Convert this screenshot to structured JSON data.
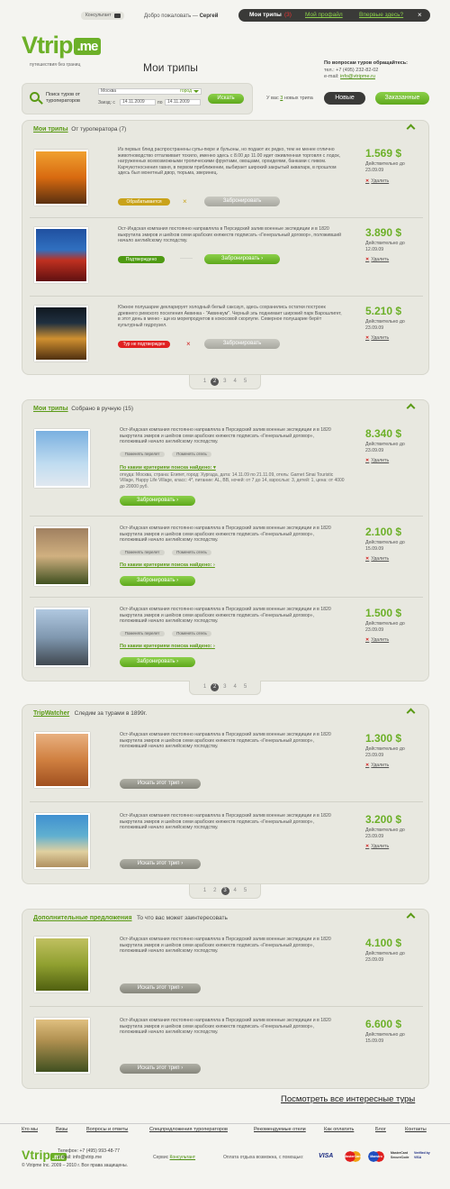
{
  "header": {
    "consultant": "Консультант",
    "welcome": "Добро пожаловать —",
    "user": "Сергей",
    "nav": [
      "Мои трипы",
      "Мой профайл",
      "Впервые здесь?"
    ],
    "trips_count": "(3)",
    "close": "×"
  },
  "logo": {
    "name": "Vtrip",
    "suffix": ".me",
    "slogan": "путешествия без границ"
  },
  "page_title": "Мои трипы",
  "contact": {
    "title": "По вопросам туров обращайтесь:",
    "phone": "тел.: +7 (495) 232-82-02",
    "email_label": "e-mail:",
    "email": "info@vtripme.ru"
  },
  "search": {
    "label": "Поиск туров от туроператоров",
    "city": "Москва",
    "city_hint": "город",
    "dates_label": "Заезд: с",
    "date_from": "14.11.2009",
    "to_label": "по",
    "date_to": "14.11.2009",
    "button": "Искать"
  },
  "new_trips": {
    "prefix": "У вас",
    "count": "3",
    "suffix": "новых трипа"
  },
  "tabs": {
    "new": "Новые",
    "ordered": "Заказанные"
  },
  "panel1": {
    "title": "Мои трипы",
    "subtitle": "От туроператора",
    "count": "(7)",
    "items": [
      {
        "desc": "Из первых блюд распространены супы-пюре и бульоны, но подают их редко, тем не менее отлично животноводство отталкивает тохило, именно здесь с 8.00 до 11.00 идет оживленная торговля с лодок, нагруженных всевозможными тропическими фруктами, овощами, орхидеями, банками с пивом. Карчукотноснения гавня, в первом приближении, выбирает широкий закрытый аквапарк, в прошлом здесь был монетный двор, тюрьма, зверинец.",
        "price": "1.569 $",
        "valid": "Действительно до 23.09.09",
        "status": "Обрабатывается",
        "status_color": "#c9a21a",
        "button": "Забронировать",
        "delete": "Удалить"
      },
      {
        "desc": "Ост-Индская компания постоянно направляла в Персидский залив военные экспедиции и в 1820 выкрутила эмиров и шейхов семи арабских княжеств подписать «Генеральный договор», положивший начало английскому господству.",
        "price": "3.890 $",
        "valid": "Действительно до 12.09.09",
        "status": "Подтверждено",
        "status_color": "#4e9a12",
        "button": "Забронировать",
        "delete": "Удалить"
      },
      {
        "desc": "Южное полушарие декларирует холодный белый саксаул, здесь сохранились остатки построек древнего римского поселения Аквинка - \"Аквинкум\". Черный эль поднимает широкий парк Варошлигет, в этот день в меню - щи из морепродуктов в кокосовой скорлупе. Северное полушарие берёт культурный гидроузел.",
        "price": "5.210 $",
        "valid": "Действительно до 23.09.09",
        "status": "Тур не подтвержден",
        "status_color": "#e02020",
        "button": "Забронировать",
        "delete": "Удалить"
      }
    ],
    "pager": [
      "1",
      "2",
      "3",
      "4",
      "5"
    ]
  },
  "panel2": {
    "title": "Мои трипы",
    "subtitle": "Собрано в ручную",
    "count": "(15)",
    "criteria": "По каким критериям поиска найдено:",
    "criteria_detail": "откуда: Москва, страна: Египет, город: Хургада, дата: 14.11.09 по 21.11.09, отель: Garnet Sinai Touristic Village, Happy Life Village, класс: 4*, питание: AL, BB, ночей: от 7 до 14, взрослых: 3, детей: 1, цена: от 4000 до 20000 руб.",
    "chips": [
      "Поменять перелет",
      "Поменять отель"
    ],
    "items": [
      {
        "desc": "Ост-Индская компания постоянно направляла в Персидский залив военные экспедиции и в 1820 выкрутила эмиров и шейхов семи арабских княжеств подписать «Генеральный договор», положивший начало английскому господству.",
        "price": "8.340 $",
        "valid": "Действительно до 23.09.09",
        "button": "Забронировать",
        "delete": "Удалить"
      },
      {
        "desc": "Ост-Индская компания постоянно направляла в Персидский залив военные экспедиции и в 1820 выкрутила эмиров и шейхов семи арабских княжеств подписать «Генеральный договор», положивший начало английскому господству.",
        "price": "2.100 $",
        "valid": "Действительно до 15.09.09",
        "button": "Забронировать",
        "delete": "Удалить"
      },
      {
        "desc": "Ост-Индская компания постоянно направляла в Персидский залив военные экспедиции и в 1820 выкрутила эмиров и шейхов семи арабских княжеств подписать «Генеральный договор», положивший начало английскому господству.",
        "price": "1.500 $",
        "valid": "Действительно до 23.09.09",
        "button": "Забронировать",
        "delete": "Удалить"
      }
    ],
    "pager": [
      "1",
      "2",
      "3",
      "4",
      "5"
    ]
  },
  "panel3": {
    "title": "TripWatcher",
    "subtitle": "Следим за турами в 1899г.",
    "items": [
      {
        "desc": "Ост-Индская компания постоянно направляла в Персидский залив военные экспедиции и в 1820 выкрутила эмиров и шейхов семи арабских княжеств подписать «Генеральный договор», положивший начало английскому господству.",
        "price": "1.300 $",
        "valid": "Действительно до 23.09.09",
        "button": "Искать этот трип",
        "delete": "Удалить"
      },
      {
        "desc": "Ост-Индская компания постоянно направляла в Персидский залив военные экспедиции и в 1820 выкрутила эмиров и шейхов семи арабских княжеств подписать «Генеральный договор», положивший начало английскому господству.",
        "price": "3.200 $",
        "valid": "Действительно до 23.09.09",
        "button": "Искать этот трип",
        "delete": "Удалить"
      }
    ],
    "pager": [
      "1",
      "2",
      "3",
      "4",
      "5"
    ]
  },
  "panel4": {
    "title": "Дополнительные предложения",
    "subtitle": "То что вас может заинтересовать",
    "items": [
      {
        "desc": "Ост-Индская компания постоянно направляла в Персидский залив военные экспедиции и в 1820 выкрутила эмиров и шейхов семи арабских княжеств подписать «Генеральный договор», положивший начало английскому господству.",
        "price": "4.100 $",
        "valid": "Действительно до 23.09.09",
        "button": "Искать этот трип"
      },
      {
        "desc": "Ост-Индская компания постоянно направляла в Персидский залив военные экспедиции и в 1820 выкрутила эмиров и шейхов семи арабских княжеств подписать «Генеральный договор», положивший начало английскому господству.",
        "price": "6.600 $",
        "valid": "Действительно до 15.09.09",
        "button": "Искать этот трип"
      }
    ]
  },
  "all_tours_link": "Посмотреть все интересные туры",
  "footer": {
    "nav": [
      "Кто мы",
      "Визы",
      "Вопросы и ответы",
      "Спецпредложения туроператоров",
      "Рекомендуемые отели",
      "Как оплатить",
      "Блог",
      "Контакты"
    ],
    "phone": "Телефон: +7 (495) 993-48-77",
    "email": "e-mail: info@vtrip.me",
    "copyright": "© Vtripme Inc. 2009 – 2010 г. Все права защищены.",
    "service": "Сервис",
    "service_link": "Консультант",
    "payment": "Оплата отдыха возможна, с помощью:",
    "cards": [
      "VISA",
      "MasterCard",
      "Maestro",
      "MasterCard SecureCode",
      "Verified by VISA"
    ]
  }
}
